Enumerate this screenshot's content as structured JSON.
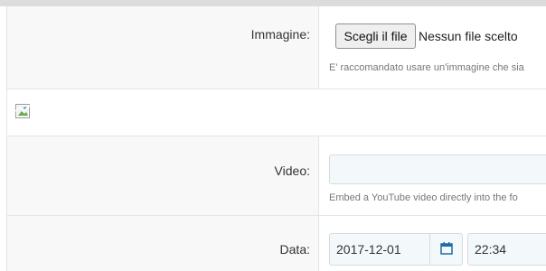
{
  "form": {
    "image": {
      "label": "Immagine:",
      "button_label": "Scegli il file",
      "status": "Nessun file scelto",
      "hint": "E' raccomandato usare un'immagine che sia"
    },
    "video": {
      "label": "Video:",
      "value": "",
      "hint": "Embed a YouTube video directly into the fo"
    },
    "date": {
      "label": "Data:",
      "date_value": "2017-12-01",
      "time_value": "22:34"
    }
  },
  "icons": {
    "preview": "broken-image-icon",
    "calendar": "calendar-icon"
  },
  "colors": {
    "accent": "#1f6ba8",
    "input_bg": "#f3f8fb",
    "label_bg": "#f8f8f8"
  }
}
